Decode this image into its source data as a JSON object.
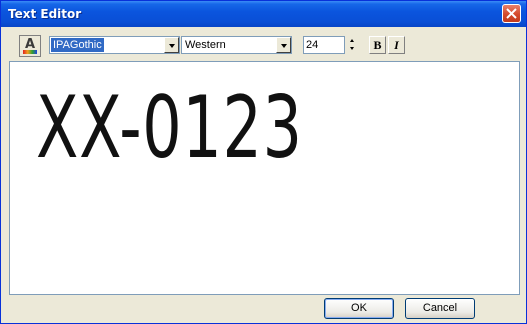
{
  "window": {
    "title": "Text Editor",
    "title_bar_color": "#0a4fd6",
    "close_icon": "close-icon"
  },
  "toolbar": {
    "color_icon": "text-color-icon",
    "font_family": "IPAGothic",
    "script": "Western",
    "font_size": "24",
    "bold_label": "B",
    "italic_label": "I"
  },
  "editor": {
    "content": "XX-0123"
  },
  "buttons": {
    "ok_label": "OK",
    "cancel_label": "Cancel"
  }
}
